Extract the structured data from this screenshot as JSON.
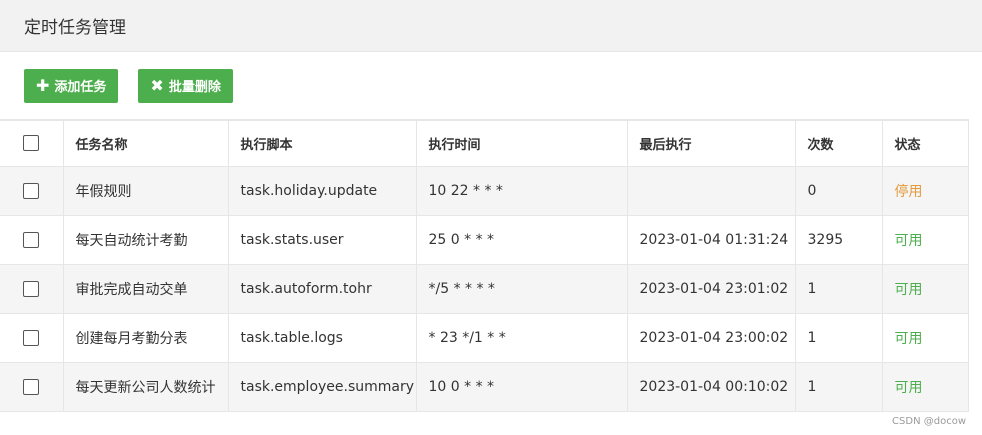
{
  "page": {
    "title": "定时任务管理"
  },
  "toolbar": {
    "add_label": "添加任务",
    "batch_delete_label": "批量删除"
  },
  "table": {
    "headers": [
      "任务名称",
      "执行脚本",
      "执行时间",
      "最后执行",
      "次数",
      "状态"
    ],
    "rows": [
      {
        "name": "年假规则",
        "script": "task.holiday.update",
        "cron": "10 22 * * *",
        "last_run": "",
        "count": "0",
        "status": "停用"
      },
      {
        "name": "每天自动统计考勤",
        "script": "task.stats.user",
        "cron": "25 0 * * *",
        "last_run": "2023-01-04 01:31:24",
        "count": "3295",
        "status": "可用"
      },
      {
        "name": "审批完成自动交单",
        "script": "task.autoform.tohr",
        "cron": "*/5 * * * *",
        "last_run": "2023-01-04 23:01:02",
        "count": "1",
        "status": "可用"
      },
      {
        "name": "创建每月考勤分表",
        "script": "task.table.logs",
        "cron": "* 23 */1 * *",
        "last_run": "2023-01-04 23:00:02",
        "count": "1",
        "status": "可用"
      },
      {
        "name": "每天更新公司人数统计",
        "script": "task.employee.summary",
        "cron": "10 0 * * *",
        "last_run": "2023-01-04 00:10:02",
        "count": "1",
        "status": "可用"
      }
    ]
  },
  "colors": {
    "button_green": "#4cae4c",
    "status_enabled": "#4cae4c",
    "status_disabled": "#e39b3b"
  },
  "icons": {
    "add": "plus-icon",
    "delete": "x-icon"
  },
  "watermark": "CSDN @docow"
}
